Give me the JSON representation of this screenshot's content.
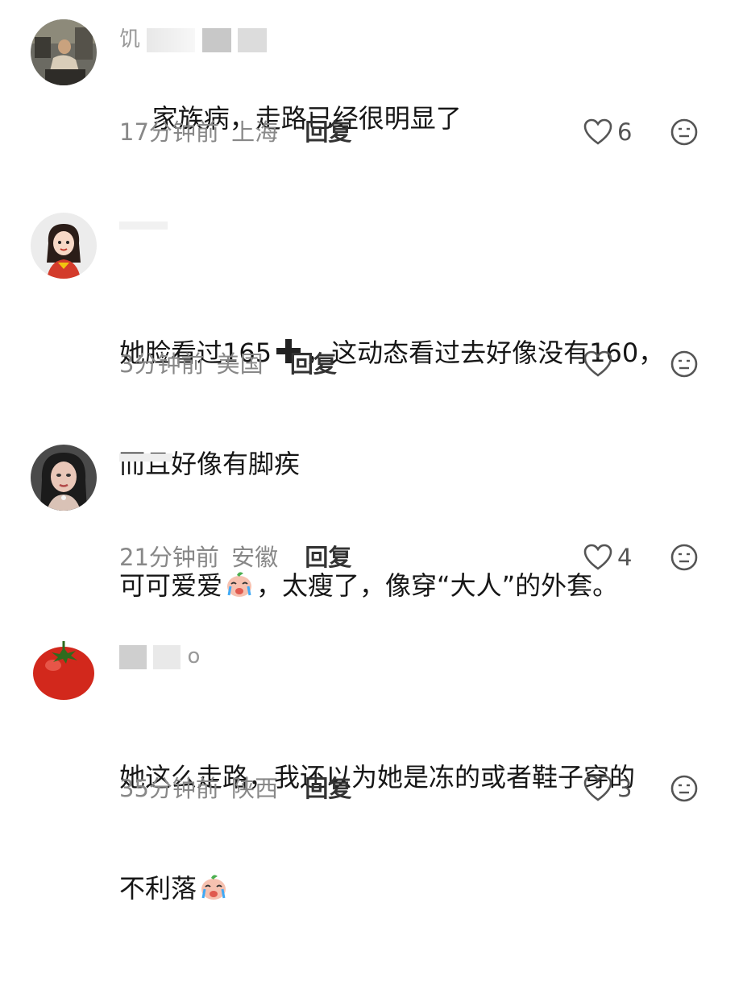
{
  "comments": [
    {
      "username": "饥",
      "text": "家族病，走路已经很明显了",
      "text_b": "",
      "time": "17分钟前",
      "location": "上海",
      "reply": "回复",
      "likes": "6",
      "avatar_icon": "man-in-chair-avatar-icon"
    },
    {
      "username": "",
      "text": "她脸看过165",
      "text_b": "，这动态看过去好像没有160，",
      "text_c": "而且好像有脚疾",
      "time": "3分钟前",
      "location": "美国",
      "reply": "回复",
      "likes": "",
      "avatar_icon": "cartoon-girl-avatar-icon"
    },
    {
      "username": "",
      "text": "可可爱爱",
      "text_b": "，太瘦了，像穿“大人”的外套。",
      "time": "21分钟前",
      "location": "安徽",
      "reply": "回复",
      "likes": "4",
      "avatar_icon": "woman-portrait-avatar-icon"
    },
    {
      "username": "o",
      "text": "她这么走路，我还以为她是冻的或者鞋子穿的",
      "text_b": "不利落",
      "time": "35分钟前",
      "location": "陕西",
      "reply": "回复",
      "likes": "3",
      "avatar_icon": "tomato-avatar-icon"
    }
  ],
  "colors": {
    "meta_gray": "#888888",
    "text": "#161616",
    "icon": "#555555"
  },
  "icons": {
    "like": "heart-outline-icon",
    "dislike": "neutral-face-icon",
    "plus": "heavy-plus-emoji-icon",
    "crying": "crying-peach-emoji-icon"
  }
}
